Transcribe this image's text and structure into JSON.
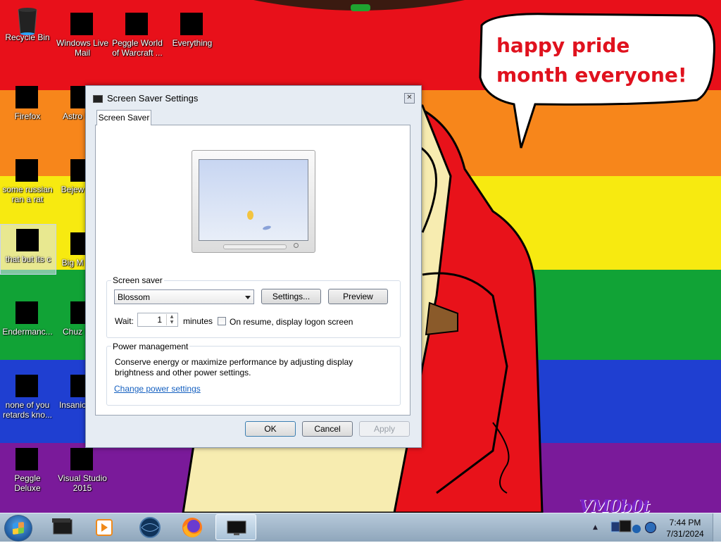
{
  "desktop": {
    "speech_bubble": "happy pride month everyone!",
    "watermark": "VM0b0t",
    "icons": [
      {
        "label": "Recycle Bin"
      },
      {
        "label": "Windows Live Mail"
      },
      {
        "label": "Peggle World of Warcraft ..."
      },
      {
        "label": "Everything"
      },
      {
        "label": "Firefox"
      },
      {
        "label": "Astro Delu"
      },
      {
        "label": "some russian ran a rat"
      },
      {
        "label": "Bejew Delu"
      },
      {
        "label": "that but its c"
      },
      {
        "label": "Big M Delu"
      },
      {
        "label": "Endermanc..."
      },
      {
        "label": "Chuz Delu"
      },
      {
        "label": "none of you retards kno..."
      },
      {
        "label": "Insanic Delu"
      },
      {
        "label": "Peggle Deluxe"
      },
      {
        "label": "Visual Studio 2015"
      }
    ]
  },
  "dialog": {
    "title": "Screen Saver Settings",
    "close": "✕",
    "tab": "Screen Saver",
    "screen_saver_group": "Screen saver",
    "selected_saver": "Blossom",
    "settings_button": "Settings...",
    "preview_button": "Preview",
    "wait_label": "Wait:",
    "wait_value": "1",
    "minutes_label": "minutes",
    "resume_checkbox": "On resume, display logon screen",
    "resume_checked": false,
    "power_group": "Power management",
    "power_text": "Conserve energy or maximize performance by adjusting display brightness and other power settings.",
    "power_link": "Change power settings",
    "ok": "OK",
    "cancel": "Cancel",
    "apply": "Apply"
  },
  "taskbar": {
    "items": [
      "start-orb-icon",
      "monitor-app-icon",
      "media-player-icon",
      "globe-app-icon",
      "firefox-icon",
      "screen-saver-window-icon"
    ],
    "time": "7:44 PM",
    "date": "7/31/2024"
  }
}
